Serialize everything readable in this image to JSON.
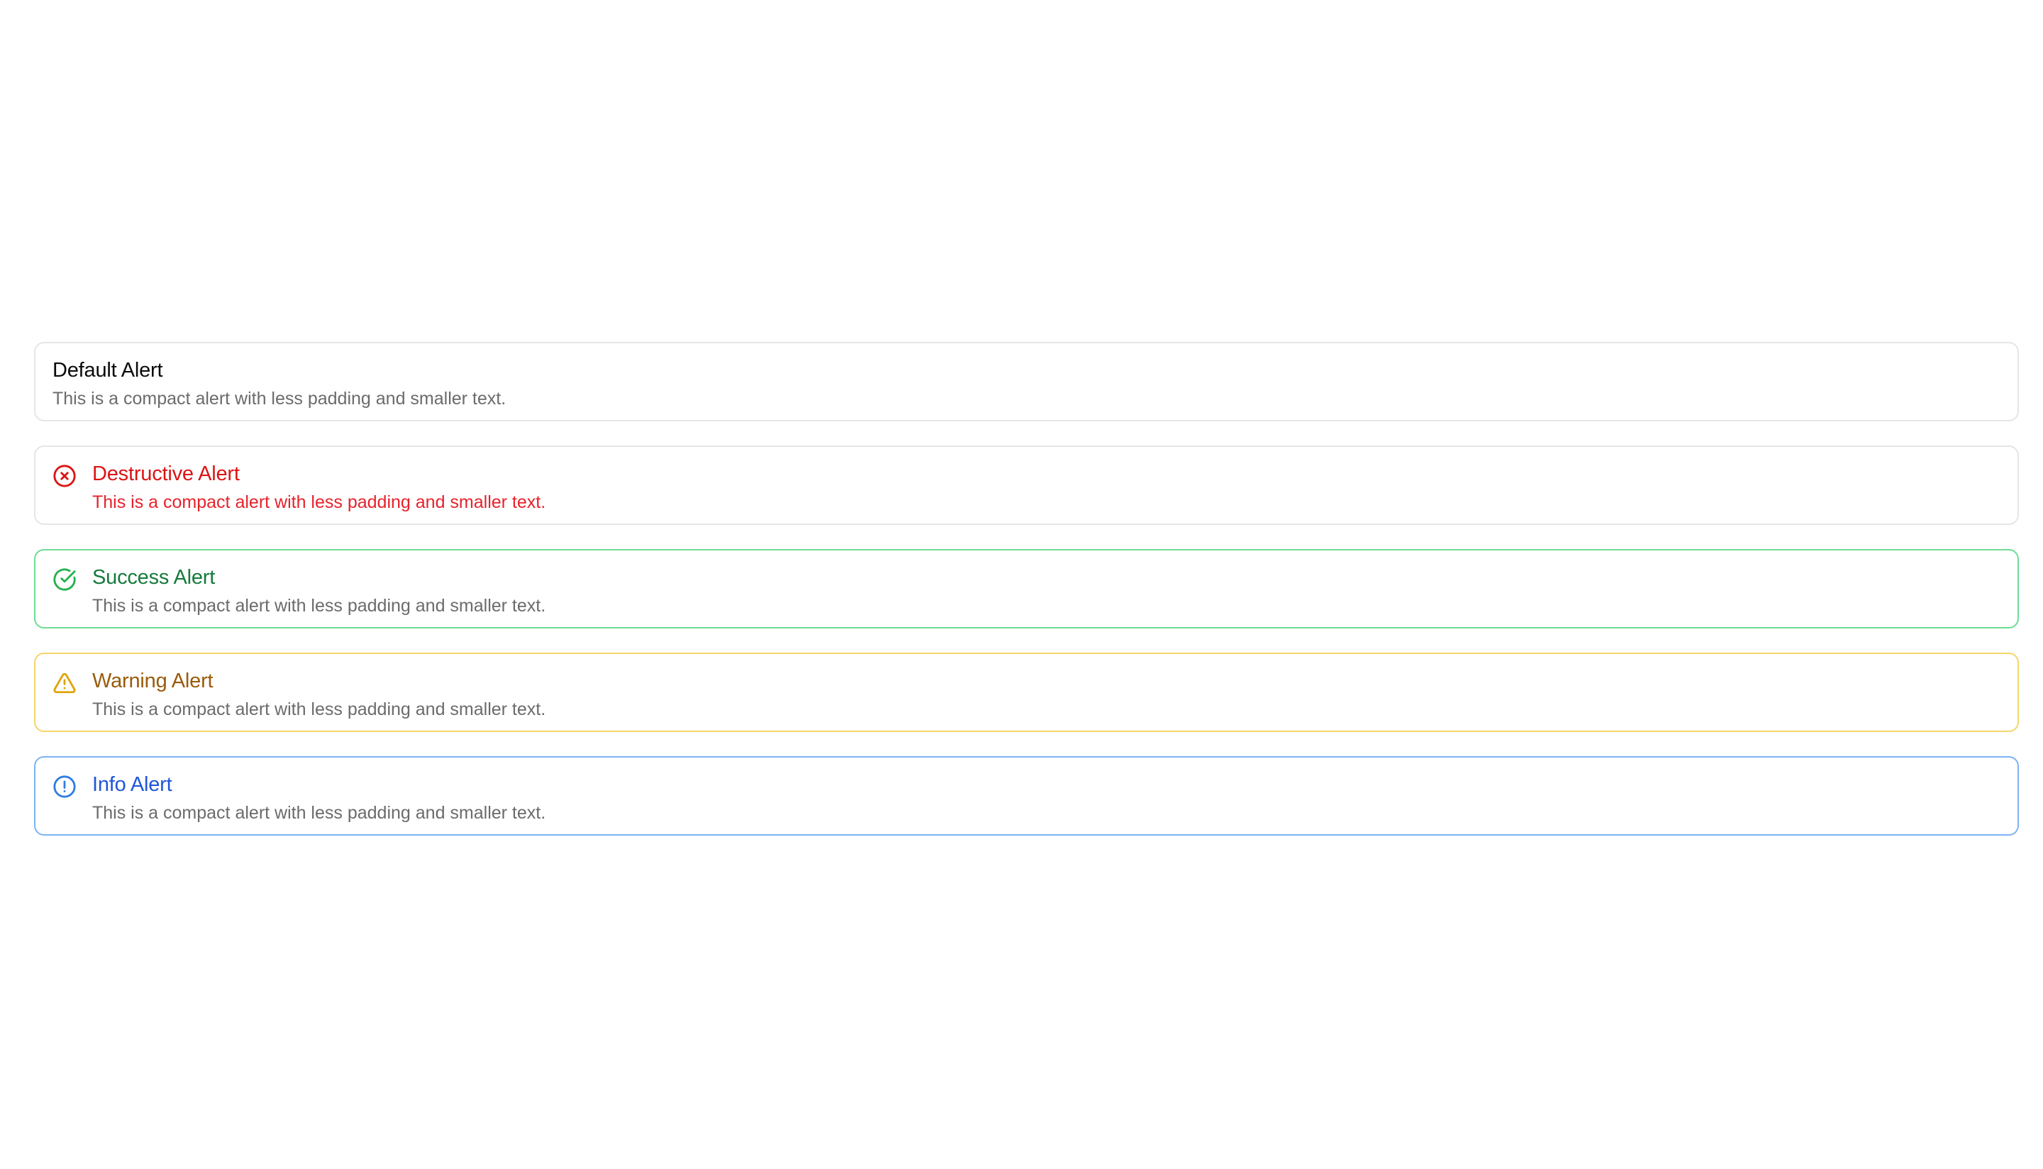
{
  "alerts": [
    {
      "variant": "default",
      "title": "Default Alert",
      "description": "This is a compact alert with less padding and smaller text.",
      "icon": null
    },
    {
      "variant": "destructive",
      "title": "Destructive Alert",
      "description": "This is a compact alert with less padding and smaller text.",
      "icon": "x-circle-icon",
      "color": "#dc1414"
    },
    {
      "variant": "success",
      "title": "Success Alert",
      "description": "This is a compact alert with less padding and smaller text.",
      "icon": "check-circle-icon",
      "color": "#22b14c"
    },
    {
      "variant": "warning",
      "title": "Warning Alert",
      "description": "This is a compact alert with less padding and smaller text.",
      "icon": "triangle-alert-icon",
      "color": "#e0a40a"
    },
    {
      "variant": "info",
      "title": "Info Alert",
      "description": "This is a compact alert with less padding and smaller text.",
      "icon": "info-circle-icon",
      "color": "#2f7de1"
    }
  ]
}
